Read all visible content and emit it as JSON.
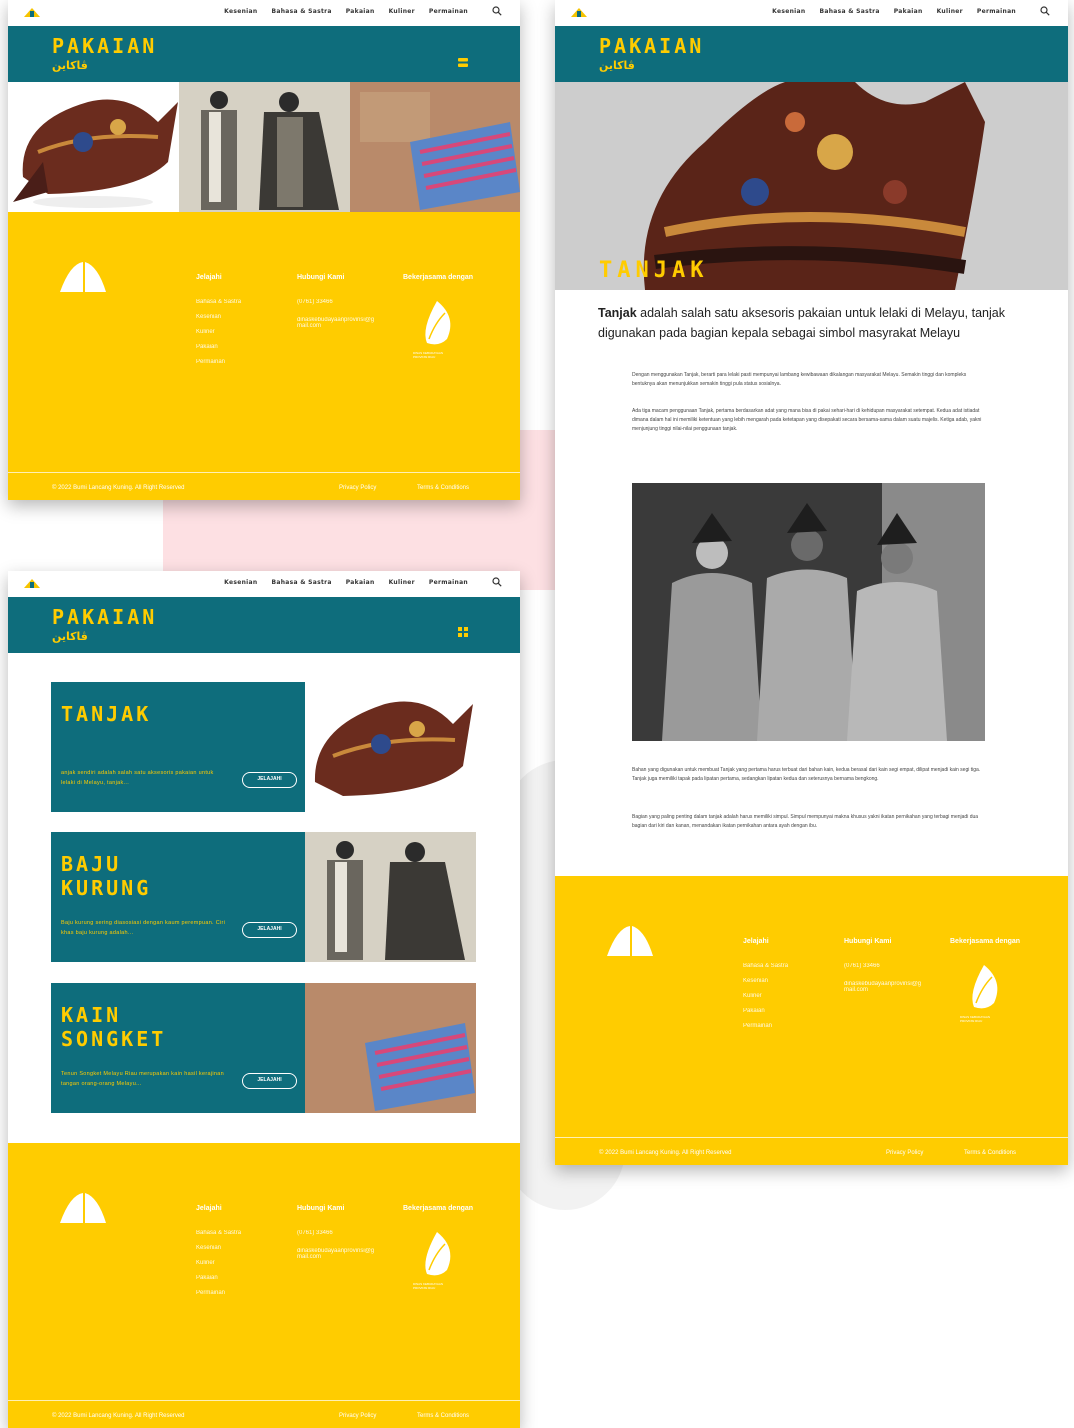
{
  "nav": {
    "links": [
      "Kesenian",
      "Bahasa & Sastra",
      "Pakaian",
      "Kuliner",
      "Permainan"
    ]
  },
  "header": {
    "title": "PAKAIAN",
    "jawi": "ڤاكاين"
  },
  "article": {
    "hero_title": "TANJAK",
    "lead_bold": "Tanjak",
    "lead_rest": " adalah salah satu aksesoris pakaian untuk lelaki di Melayu, tanjak digunakan pada bagian kepala sebagai simbol masyrakat Melayu",
    "p1": "Dengan menggunakan Tanjak, berarti para lelaki pasti mempunyai lambang kewibawaan dikalangan masyarakat Melayu. Semakin tinggi dan kompleks bentuknya akan menunjukkan semakin tinggi pula status sosialnya.",
    "p2": "Ada tiga macam penggunaan Tanjak, pertama berdasarkan adat yang mana bisa di pakai sehari-hari di kehidupan masyarakat setempat. Kedua adat istiadat dimana dalam hal ini memiliki ketentuan yang lebih mengarah pada ketetapan yang disepakati secara bersama-sama dalam suatu majelis. Ketiga adab, yakni menjunjung tinggi nilai-nilai penggunaan tanjak.",
    "p3": "Bahan yang digunakan untuk membuat Tanjak yang pertama harus terbuat dari bahan kain, kedua berasal dari kain segi empat, dilipat menjadi kain segi tiga. Tanjak juga memiliki tapak pada lipatan pertama, sedangkan lipatan kedua dan seterusnya bernama bengkong.",
    "p4": "Bagian yang paling penting dalam tanjak adalah harus memiliki simpul. Simpul mempunyai makna khusus yakni ikatan pernikahan yang terbagi menjadi dua bagian dari kiri dan kanan, menandakan ikatan pernikahan antara ayah dengan ibu."
  },
  "cards": [
    {
      "title": "TANJAK",
      "desc": "anjak sendiri adalah salah satu aksesoris pakaian untuk lelaki di Melayu, tanjak...",
      "button": "JELAJAHI"
    },
    {
      "title": "BAJU KURUNG",
      "desc": "Baju kurung sering diasosiasi dengan kaum perempuan. Ciri khas baju kurung adalah...",
      "button": "JELAJAHI"
    },
    {
      "title": "KAIN SONGKET",
      "desc": "Tenun Songket Melayu Riau merupakan kain hasil kerajinan tangan orang-orang Melayu...",
      "button": "JELAJAHI"
    }
  ],
  "footer": {
    "explore_heading": "Jelajahi",
    "explore_links": [
      "Bahasa & Sastra",
      "Kesenian",
      "Kuliner",
      "Pakaian",
      "Permainan"
    ],
    "contact_heading": "Hubungi Kami",
    "phone": "(0761) 33466",
    "email": "dinaskebudayaanprovinsi@gmail.com",
    "partner_heading": "Bekerjasama dengan",
    "partner_name": "DINAS KEBUDAYAAN PROVINSI RIAU",
    "copyright": "© 2022 Bumi Lancang Kuning. All Right Reserved",
    "privacy": "Privacy Policy",
    "terms": "Terms & Conditions"
  },
  "colors": {
    "teal": "#0e6d7c",
    "yellow": "#ffcc00",
    "pink": "#fde0e3"
  }
}
